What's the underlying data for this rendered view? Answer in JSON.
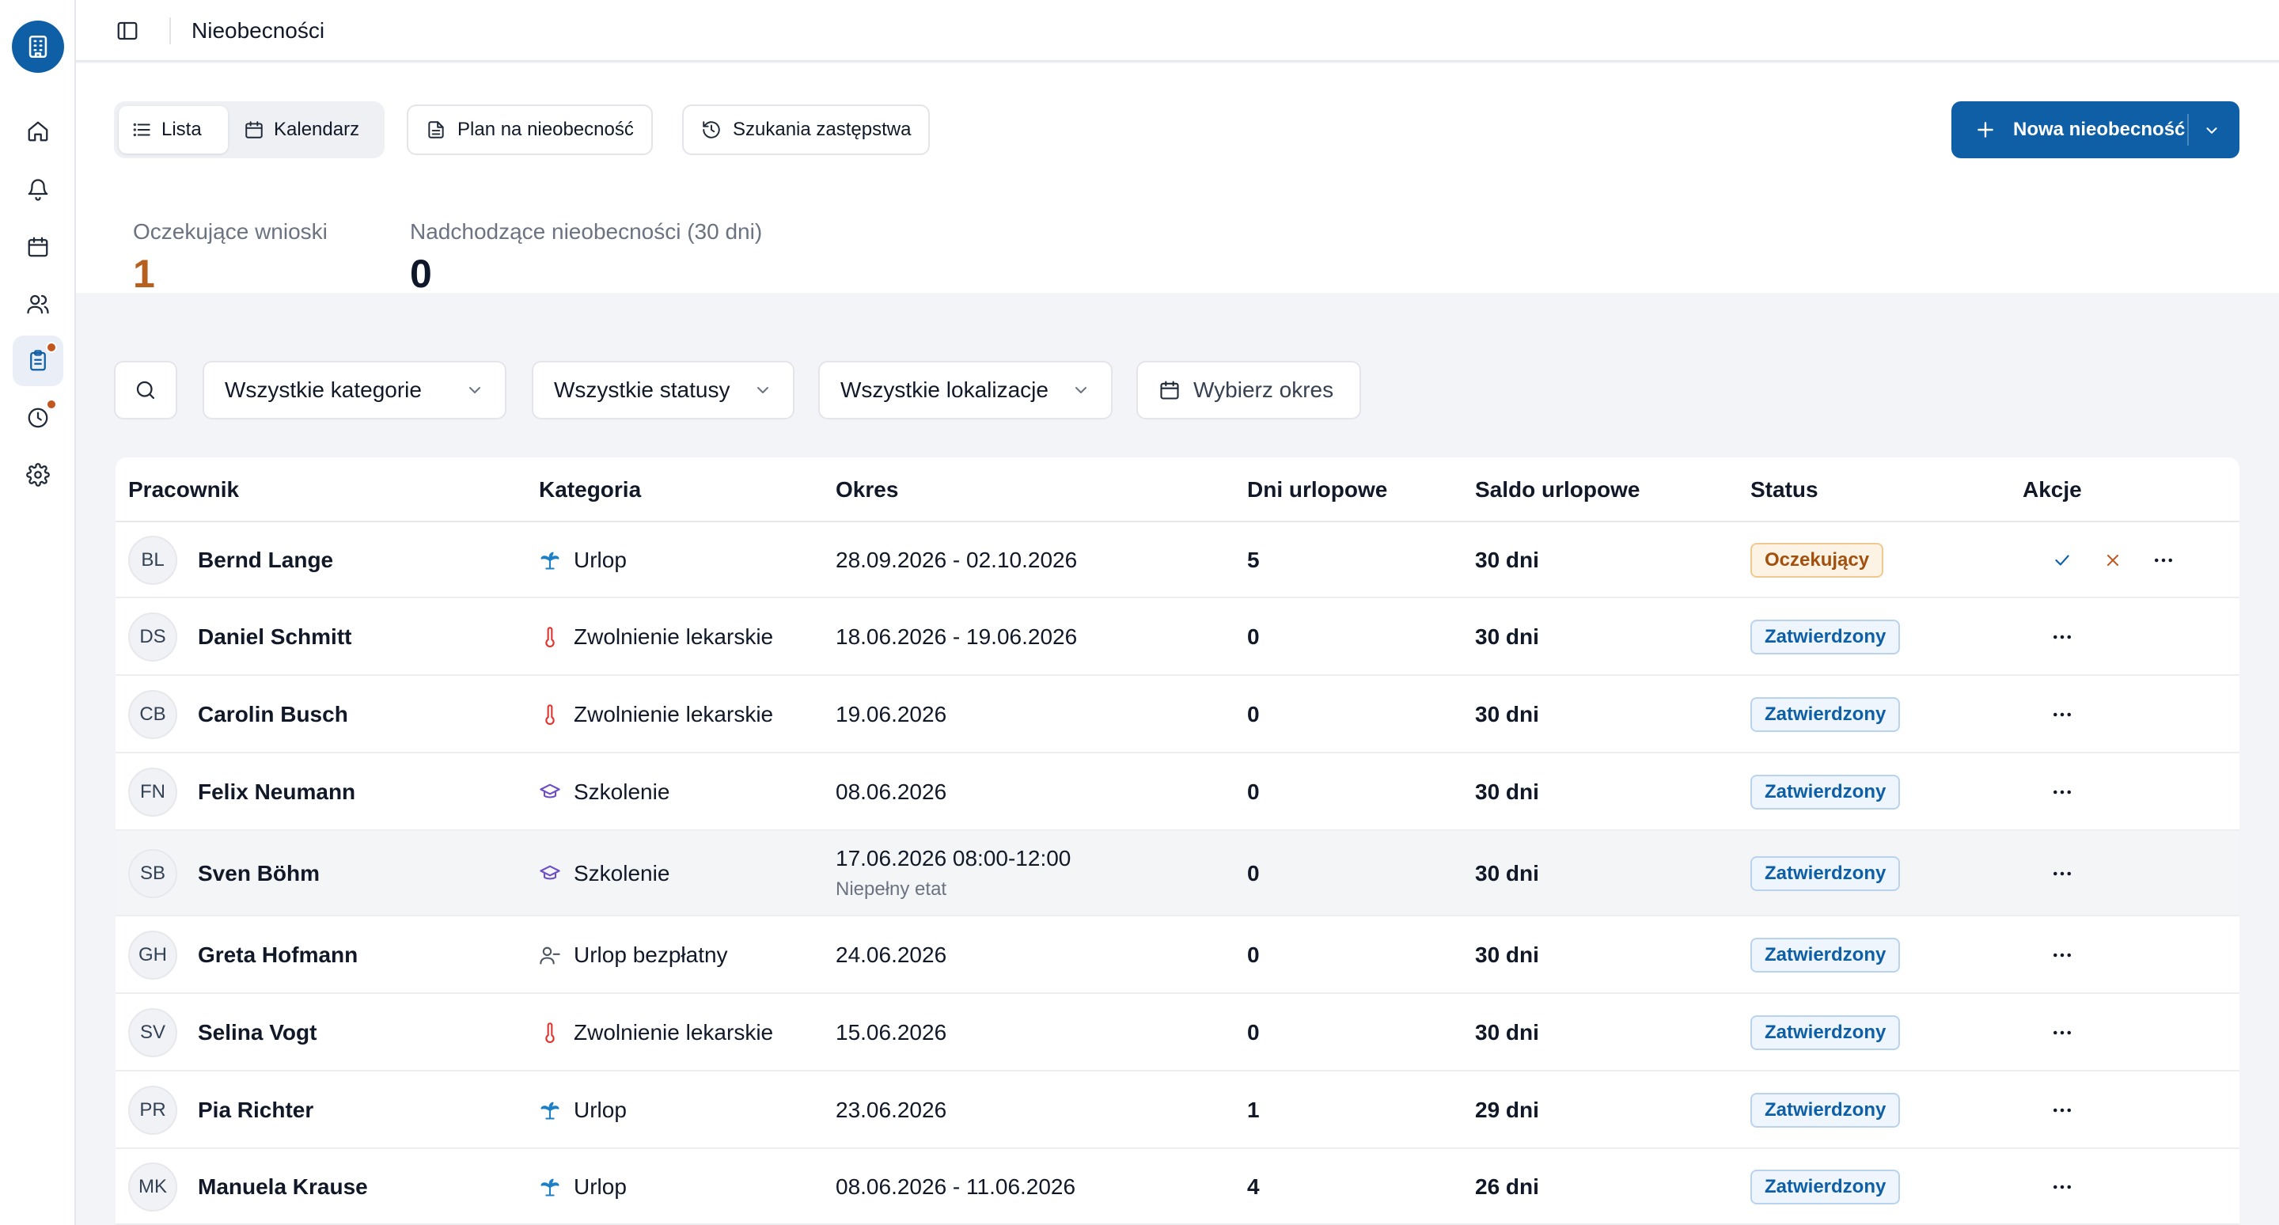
{
  "sidebar": {
    "logo_icon": "building-icon",
    "items": [
      {
        "name": "home",
        "icon": "home-icon",
        "active": false,
        "badge": false
      },
      {
        "name": "notifications",
        "icon": "bell-icon",
        "active": false,
        "badge": false
      },
      {
        "name": "calendar",
        "icon": "calendar-icon",
        "active": false,
        "badge": false
      },
      {
        "name": "employees",
        "icon": "users-icon",
        "active": false,
        "badge": false
      },
      {
        "name": "absences",
        "icon": "clipboard-icon",
        "active": true,
        "badge": true
      },
      {
        "name": "time",
        "icon": "clock-icon",
        "active": false,
        "badge": true
      },
      {
        "name": "settings",
        "icon": "gear-icon",
        "active": false,
        "badge": false
      }
    ]
  },
  "topbar": {
    "title": "Nieobecności"
  },
  "view_toggle": {
    "list_label": "Lista",
    "calendar_label": "Kalendarz",
    "active": "list"
  },
  "toolbar": {
    "plan_label": "Plan na nieobecność",
    "substitute_label": "Szukania zastępstwa",
    "new_absence_label": "Nowa nieobecność"
  },
  "stats": {
    "pending_label": "Oczekujące wnioski",
    "pending_value": "1",
    "upcoming_label": "Nadchodzące nieobecności (30 dni)",
    "upcoming_value": "0"
  },
  "filters": {
    "category": "Wszystkie kategorie",
    "status": "Wszystkie statusy",
    "location": "Wszystkie lokalizacje",
    "period_placeholder": "Wybierz okres"
  },
  "table": {
    "headers": {
      "employee": "Pracownik",
      "category": "Kategoria",
      "period": "Okres",
      "vacation_days": "Dni urlopowe",
      "vacation_balance": "Saldo urlopowe",
      "status": "Status",
      "actions": "Akcje"
    },
    "rows": [
      {
        "initials": "BL",
        "name": "Bernd Lange",
        "category": "Urlop",
        "category_icon": "palm-tree-icon",
        "period": "28.09.2026 - 02.10.2026",
        "period_note": "",
        "days": "5",
        "balance": "30 dni",
        "status": "Oczekujący",
        "status_type": "pending"
      },
      {
        "initials": "DS",
        "name": "Daniel Schmitt",
        "category": "Zwolnienie lekarskie",
        "category_icon": "thermometer-icon",
        "period": "18.06.2026 - 19.06.2026",
        "period_note": "",
        "days": "0",
        "balance": "30 dni",
        "status": "Zatwierdzony",
        "status_type": "approved"
      },
      {
        "initials": "CB",
        "name": "Carolin Busch",
        "category": "Zwolnienie lekarskie",
        "category_icon": "thermometer-icon",
        "period": "19.06.2026",
        "period_note": "",
        "days": "0",
        "balance": "30 dni",
        "status": "Zatwierdzony",
        "status_type": "approved"
      },
      {
        "initials": "FN",
        "name": "Felix Neumann",
        "category": "Szkolenie",
        "category_icon": "graduation-cap-icon",
        "period": "08.06.2026",
        "period_note": "",
        "days": "0",
        "balance": "30 dni",
        "status": "Zatwierdzony",
        "status_type": "approved"
      },
      {
        "initials": "SB",
        "name": "Sven Böhm",
        "category": "Szkolenie",
        "category_icon": "graduation-cap-icon",
        "period": "17.06.2026 08:00-12:00",
        "period_note": "Niepełny etat",
        "days": "0",
        "balance": "30 dni",
        "status": "Zatwierdzony",
        "status_type": "approved"
      },
      {
        "initials": "GH",
        "name": "Greta Hofmann",
        "category": "Urlop bezpłatny",
        "category_icon": "user-minus-icon",
        "period": "24.06.2026",
        "period_note": "",
        "days": "0",
        "balance": "30 dni",
        "status": "Zatwierdzony",
        "status_type": "approved"
      },
      {
        "initials": "SV",
        "name": "Selina Vogt",
        "category": "Zwolnienie lekarskie",
        "category_icon": "thermometer-icon",
        "period": "15.06.2026",
        "period_note": "",
        "days": "0",
        "balance": "30 dni",
        "status": "Zatwierdzony",
        "status_type": "approved"
      },
      {
        "initials": "PR",
        "name": "Pia Richter",
        "category": "Urlop",
        "category_icon": "palm-tree-icon",
        "period": "23.06.2026",
        "period_note": "",
        "days": "1",
        "balance": "29 dni",
        "status": "Zatwierdzony",
        "status_type": "approved"
      },
      {
        "initials": "MK",
        "name": "Manuela Krause",
        "category": "Urlop",
        "category_icon": "palm-tree-icon",
        "period": "08.06.2026 - 11.06.2026",
        "period_note": "",
        "days": "4",
        "balance": "26 dni",
        "status": "Zatwierdzony",
        "status_type": "approved"
      }
    ]
  },
  "colors": {
    "primary": "#0e5fa6",
    "pending_accent": "#b5601f",
    "badge_dot": "#c2561e",
    "thermometer": "#e0342f",
    "palm_tree": "#1d7fc4",
    "graduation_cap": "#6d4fc7",
    "approve_check": "#0e5fa6",
    "reject_x": "#c2561e"
  }
}
